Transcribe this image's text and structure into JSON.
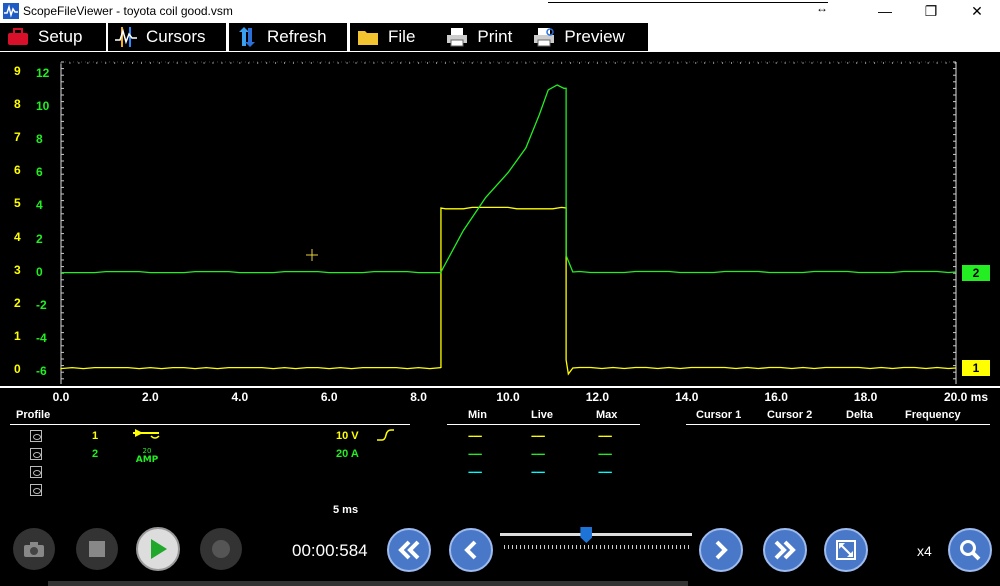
{
  "window": {
    "title": "ScopeFileViewer - toyota coil good.vsm",
    "resize_glyph": "↔",
    "minimize": "—",
    "maximize": "❐",
    "close": "✕"
  },
  "toolbar": {
    "setup": "Setup",
    "cursors": "Cursors",
    "refresh": "Refresh",
    "file": "File",
    "print": "Print",
    "preview": "Preview"
  },
  "scale1": [
    "9",
    "8",
    "7",
    "6",
    "5",
    "4",
    "3",
    "2",
    "1",
    "0"
  ],
  "scale2": [
    "12",
    "10",
    "8",
    "6",
    "4",
    "2",
    "0",
    "-2",
    "-4",
    "-6"
  ],
  "channel_badges": {
    "ch2": "2",
    "ch1": "1"
  },
  "x_axis": {
    "labels": [
      "0.0",
      "2.0",
      "4.0",
      "6.0",
      "8.0",
      "10.0",
      "12.0",
      "14.0",
      "16.0",
      "18.0"
    ],
    "last_label": "20.0 ms"
  },
  "panel": {
    "profile_header": "Profile",
    "stats_headers": {
      "min": "Min",
      "live": "Live",
      "max": "Max"
    },
    "cursor_headers": {
      "cursor1": "Cursor 1",
      "cursor2": "Cursor 2",
      "delta": "Delta",
      "frequency": "Frequency"
    },
    "channels": [
      {
        "num": "1",
        "scale": "10 V",
        "color": "#ffff00"
      },
      {
        "num": "2",
        "scale": "20 A",
        "color": "#22ee22"
      }
    ],
    "amp_probe_label": "20 AMP",
    "dash": "-----",
    "timebase": "5 ms"
  },
  "controls": {
    "time": "00:00:584",
    "zoom": "x4",
    "slider_position": 0.45
  },
  "colors": {
    "ch1": "#ffff00",
    "ch2": "#22ee22",
    "cyan": "#00ffff",
    "button_blue": "#4a78c8",
    "badge_green": "#22ee22",
    "badge_yellow": "#ffff00"
  }
}
